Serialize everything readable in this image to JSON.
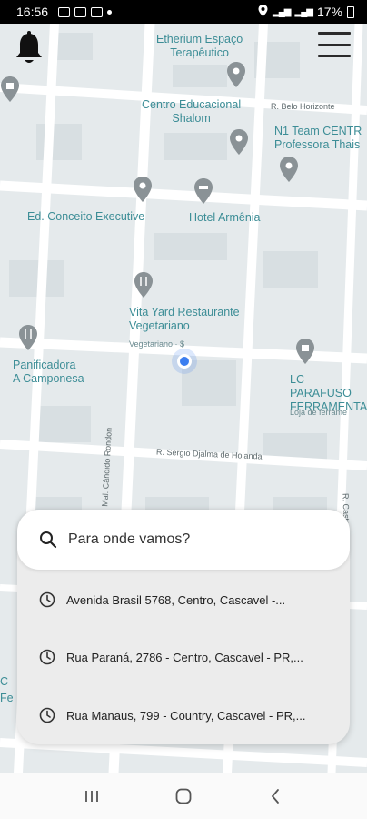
{
  "status_bar": {
    "time": "16:56",
    "battery": "17%"
  },
  "map": {
    "places": [
      {
        "name": "Etherium Espaço\nTerapêutico"
      },
      {
        "name": "Centro Educacional\nShalom"
      },
      {
        "name": "N1 Team CENTR\nProfessora Thais"
      },
      {
        "name": "Ed. Conceito Executive"
      },
      {
        "name": "Hotel Armênia"
      },
      {
        "name": "Vita Yard Restaurante\nVegetariano"
      },
      {
        "name": "Panificadora\nA Camponesa"
      },
      {
        "name": "LC PARAFUSO\nFERRAMENTA"
      }
    ],
    "place_subtitles": {
      "vita_yard": "Vegetariano · $",
      "lc": "Loja de ferrame"
    },
    "streets": {
      "belo_horizonte": "R. Belo Horizonte",
      "sergio": "R. Sergio Djalma de Holanda",
      "candido": "R. Mal. Cândido Rondon",
      "castro": "R. Castro",
      "fe": "Fe",
      "c": "C"
    }
  },
  "search": {
    "placeholder": "Para onde vamos?"
  },
  "recent_destinations": [
    {
      "label": "Avenida Brasil 5768, Centro, Cascavel -..."
    },
    {
      "label": "Rua Paraná, 2786 - Centro, Cascavel - PR,..."
    },
    {
      "label": "Rua Manaus, 799 - Country, Cascavel - PR,..."
    }
  ]
}
